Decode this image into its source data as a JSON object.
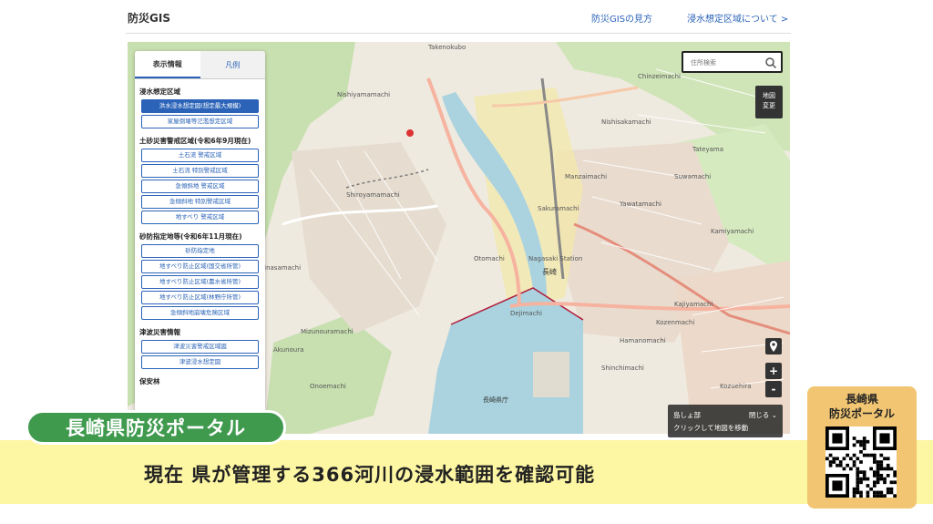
{
  "header": {
    "brand": "防災GIS",
    "link_guide": "防災GISの見方",
    "link_flood": "浸水想定区域について >"
  },
  "panel": {
    "tabs": [
      "表示情報",
      "凡例"
    ],
    "sections": [
      {
        "title": "浸水想定区域",
        "buttons": [
          "洪水浸水想定図(想定最大規模)",
          "家屋倒壊等氾濫想定区域"
        ]
      },
      {
        "title": "土砂災害警戒区域(令和6年9月現在)",
        "buttons": [
          "土石流 警戒区域",
          "土石流 特別警戒区域",
          "急傾斜地 警戒区域",
          "急傾斜地 特別警戒区域",
          "地すべり 警戒区域"
        ]
      },
      {
        "title": "砂防指定地等(令和6年11月現在)",
        "buttons": [
          "砂防指定地",
          "地すべり防止区域(国交省所管)",
          "地すべり防止区域(農水省所管)",
          "地すべり防止区域(林野庁所管)",
          "急傾斜地崩壊危険区域"
        ]
      },
      {
        "title": "津波災害情報",
        "buttons": [
          "津波災害警戒区域図",
          "津波浸水想定図"
        ]
      },
      {
        "title": "保安林",
        "buttons": []
      }
    ]
  },
  "map": {
    "search_placeholder": "住所検索",
    "map_change": [
      "地図",
      "変更"
    ],
    "zoom_in": "+",
    "zoom_out": "-",
    "island_label": "島しょ部",
    "island_close": "閉じる",
    "island_hint": "クリックして地図を移動",
    "place_labels": [
      "Takenokubo",
      "Nishiyamamachi",
      "Shiroyamamachi",
      "Inasamachi",
      "Akunoura",
      "Chinzeimachi",
      "Nishisakamachi",
      "Manzaimachi",
      "Yawatamachi",
      "Suwamachi",
      "Kajiyamachi",
      "Tateyama",
      "Kamiyamachi",
      "Hamanomachi",
      "Kozenmachi",
      "Shinchimachi",
      "Otomachi",
      "Dejimachi",
      "Kozuehira",
      "Sakuramachi",
      "Nagasaki Station",
      "長崎",
      "長崎県庁",
      "Mizunouramachi",
      "Onoemachi"
    ]
  },
  "banner": {
    "tag": "長崎県防災ポータル",
    "caption": "現在 県が管理する366河川の浸水範囲を確認可能"
  },
  "qr": {
    "title": "長崎県\n防災ポータル",
    "title_line1": "長崎県",
    "title_line2": "防災ポータル"
  },
  "colors": {
    "accent": "#2a63b8",
    "green_tag": "#3f9a4e",
    "caption_bg": "#fdf6a3",
    "qr_bg": "#f1c572",
    "water": "#aad3df",
    "park": "#c8e0b0"
  }
}
